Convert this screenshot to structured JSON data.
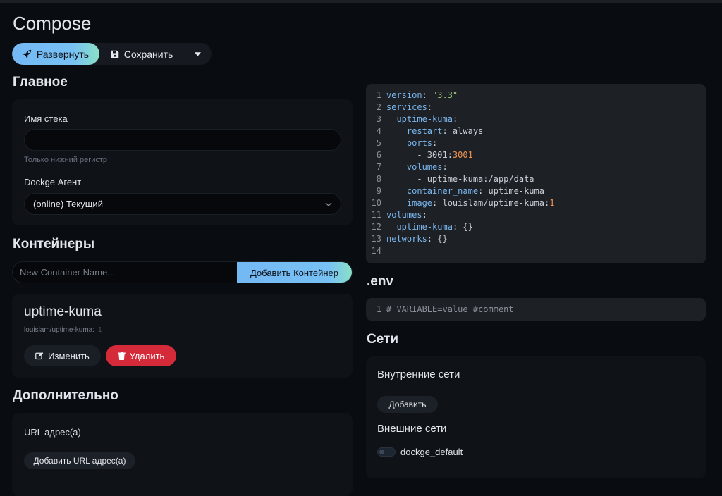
{
  "page": {
    "title": "Compose"
  },
  "toolbar": {
    "deploy_label": "Развернуть",
    "save_label": "Сохранить"
  },
  "general": {
    "title": "Главное",
    "stack_name_label": "Имя стека",
    "stack_name_value": "",
    "stack_name_hint": "Только нижний регистр",
    "agent_label": "Dockge Агент",
    "agent_selected": "(online) Текущий"
  },
  "containers": {
    "title": "Контейнеры",
    "new_placeholder": "New Container Name...",
    "add_button": "Добавить Контейнер",
    "items": [
      {
        "name": "uptime-kuma",
        "image": "louislam/uptime-kuma:",
        "tag": "1",
        "edit_label": "Изменить",
        "delete_label": "Удалить"
      }
    ]
  },
  "extra": {
    "title": "Дополнительно",
    "url_label": "URL адрес(а)",
    "add_url_button": "Добавить URL адрес(а)"
  },
  "compose_yaml": {
    "lines": [
      {
        "n": "1",
        "text": "version: \"3.3\""
      },
      {
        "n": "2",
        "text": "services:"
      },
      {
        "n": "3",
        "text": "  uptime-kuma:"
      },
      {
        "n": "4",
        "text": "    restart: always"
      },
      {
        "n": "5",
        "text": "    ports:"
      },
      {
        "n": "6",
        "text": "      - 3001:3001"
      },
      {
        "n": "7",
        "text": "    volumes:"
      },
      {
        "n": "8",
        "text": "      - uptime-kuma:/app/data"
      },
      {
        "n": "9",
        "text": "    container_name: uptime-kuma"
      },
      {
        "n": "10",
        "text": "    image: louislam/uptime-kuma:1"
      },
      {
        "n": "11",
        "text": "volumes:"
      },
      {
        "n": "12",
        "text": "  uptime-kuma: {}"
      },
      {
        "n": "13",
        "text": "networks: {}"
      },
      {
        "n": "14",
        "text": ""
      }
    ]
  },
  "env": {
    "title": ".env",
    "lines": [
      {
        "n": "1",
        "text": "# VARIABLE=value #comment"
      }
    ]
  },
  "networks": {
    "title": "Сети",
    "internal_title": "Внутренние сети",
    "add_button": "Добавить",
    "external_title": "Внешние сети",
    "external_items": [
      {
        "name": "dockge_default",
        "enabled": false
      }
    ]
  },
  "colors": {
    "background": "#090c10",
    "card": "#0f1217",
    "accent_gradient_start": "#74b8f4",
    "accent_gradient_end": "#8be0c7",
    "danger": "#d42a3a",
    "editor_bg": "#1d2025",
    "yaml_key": "#7ab7ee",
    "yaml_string": "#98c379",
    "yaml_number": "#f0934e"
  }
}
